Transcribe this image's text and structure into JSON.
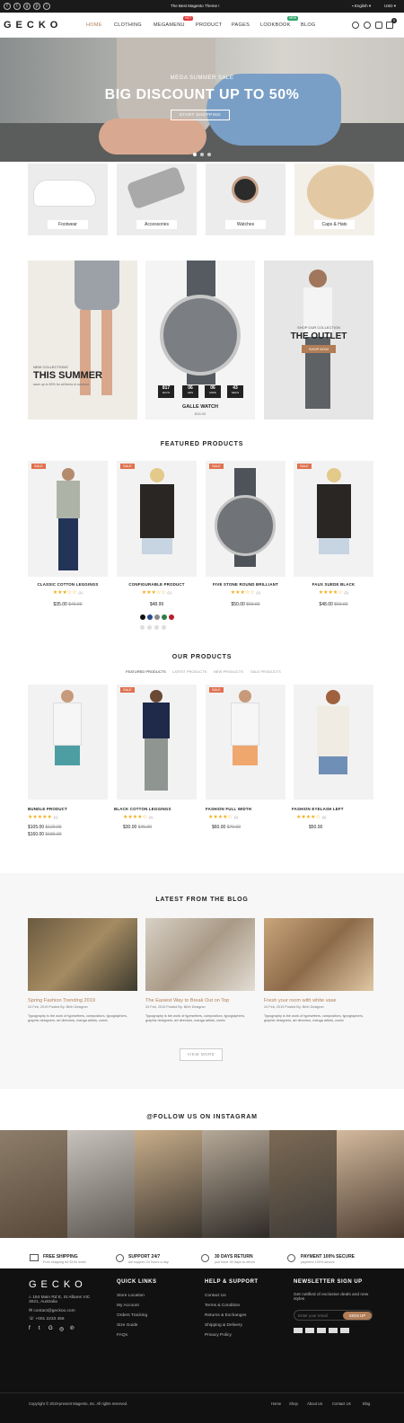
{
  "topbar": {
    "promo": "The Best Magento Theme !",
    "language": "English",
    "currency": "USD"
  },
  "header": {
    "logo": "GECKO",
    "nav": [
      "HOME",
      "CLOTHING",
      "MEGAMENU",
      "PRODUCT",
      "PAGES",
      "LOOKBOOK",
      "BLOG"
    ],
    "badges": {
      "megamenu": "HOT",
      "lookbook": "NEW"
    },
    "cart_count": "0"
  },
  "hero": {
    "eyebrow": "MEGA SUMMER SALE",
    "headline": "BIG DISCOUNT UP TO 50%",
    "cta": "START SHOPPING"
  },
  "categories": [
    "Footwear",
    "Accessories",
    "Watches",
    "Caps & Hats"
  ],
  "banners": {
    "summer": {
      "eyebrow": "NEW COLLECTIONS",
      "title": "THIS SUMMER",
      "sub": "save up to 50% for all items in summer"
    },
    "watch": {
      "countdown": [
        {
          "v": "817",
          "l": "DAYS"
        },
        {
          "v": "06",
          "l": "HRS"
        },
        {
          "v": "06",
          "l": "MINS"
        },
        {
          "v": "43",
          "l": "SECS"
        }
      ],
      "name": "GALLE WATCH",
      "price": "$15.00"
    },
    "outlet": {
      "eyebrow": "SHOP OUR COLLECTION",
      "title": "THE OUTLET",
      "cta": "SHOP NOW"
    }
  },
  "featured": {
    "title": "FEATURED PRODUCTS",
    "sale_label": "SALE",
    "items": [
      {
        "name": "CLASSIC COTTON LEGGINGS",
        "stars": "★★★☆☆",
        "reviews": "(1)",
        "price": "$35.00",
        "old": "$40.00"
      },
      {
        "name": "CONFIGURABLE PRODUCT",
        "stars": "★★★☆☆",
        "reviews": "(1)",
        "price": "$48.99",
        "old": ""
      },
      {
        "name": "FIVE STONE ROUND BRILLIANT",
        "stars": "★★★☆☆",
        "reviews": "(1)",
        "price": "$50.00",
        "old": "$60.00"
      },
      {
        "name": "FAUX SUEDE BLACK",
        "stars": "★★★★☆",
        "reviews": "(2)",
        "price": "$48.00",
        "old": "$60.00"
      }
    ],
    "swatches": [
      "#111111",
      "#2a4a8a",
      "#8a8a8a",
      "#2e7d4a",
      "#b3202a"
    ]
  },
  "ours": {
    "title": "OUR PRODUCTS",
    "tabs": [
      "FEATURED PRODUCTS",
      "LATEST PRODUCTS",
      "NEW PRODUCTS",
      "SALE PRODUCTS"
    ],
    "sale_label": "SALE",
    "items": [
      {
        "name": "BUNDLE PRODUCT",
        "stars": "★★★★★",
        "reviews": "(1)",
        "price1": "$105.00",
        "old1": "$120.00",
        "price2": "$160.00",
        "old2": "$180.00"
      },
      {
        "name": "BLACK COTTON LEGGINGS",
        "stars": "★★★★☆",
        "reviews": "(1)",
        "price1": "$30.00",
        "old1": "$45.00",
        "price2": "",
        "old2": ""
      },
      {
        "name": "FASHION FULL WIDTH",
        "stars": "★★★★☆",
        "reviews": "(1)",
        "price1": "$60.00",
        "old1": "$70.00",
        "price2": "",
        "old2": ""
      },
      {
        "name": "FASHION EYELASH LEFT",
        "stars": "★★★★☆",
        "reviews": "(2)",
        "price1": "$50.00",
        "old1": "",
        "price2": "",
        "old2": ""
      }
    ]
  },
  "blog": {
    "title": "LATEST FROM THE BLOG",
    "posts": [
      {
        "title": "Spring Fashion Trending 2019",
        "meta": "24 Feb, 2019    Posted By: Birth Designer",
        "text": "Typography is the work of typesetters, compositors, typographers, graphic designers, art directors, manga artists, comic"
      },
      {
        "title": "The Easiest Way to Break Out on Top",
        "meta": "24 Feb, 2019    Posted By: Birth Designer",
        "text": "Typography is the work of typesetters, compositors, typographers, graphic designers, art directors, manga artists, comic"
      },
      {
        "title": "Fresh your room with white vase",
        "meta": "24 Feb, 2019    Posted By: Birth Designer",
        "text": "Typography is the work of typesetters, compositors, typographers, graphic designers, art directors, manga artists, comic"
      }
    ],
    "view_more": "VIEW MORE"
  },
  "instagram": {
    "title": "@FOLLOW US ON INSTAGRAM"
  },
  "features": [
    {
      "title": "FREE SHIPPING",
      "sub": "Free shipping for $100 order"
    },
    {
      "title": "SUPPORT 24/7",
      "sub": "we support 24 hours a day"
    },
    {
      "title": "30 DAYS RETURN",
      "sub": "you have 30 days to return"
    },
    {
      "title": "PAYMENT 100% SECURE",
      "sub": "payment 100% secure"
    }
  ],
  "footer": {
    "logo": "GECKO",
    "address": "184 Main Rd E, St Albans VIC 3021, Australia",
    "email": "contact@geckoo.com",
    "phone": "+001 2233 456",
    "quick_title": "QUICK LINKS",
    "quick": [
      "Store Location",
      "My Account",
      "Orders Tracking",
      "Size Guide",
      "FAQs"
    ],
    "help_title": "HELP & SUPPORT",
    "help": [
      "Contact Us",
      "Terms & Condition",
      "Returns & Exchanges",
      "Shipping & Delivery",
      "Privacy Policy"
    ],
    "news_title": "NEWSLETTER SIGN UP",
    "news_text": "Get notified of exclusive deals and new styles",
    "email_placeholder": "Enter your email",
    "signup": "SIGN UP",
    "copyright": "Copyright © 2019-present Magento, Inc. All rights reserved.",
    "bottom_links": [
      "Home",
      "Shop",
      "About Us",
      "Contact Us",
      "Blog"
    ]
  }
}
